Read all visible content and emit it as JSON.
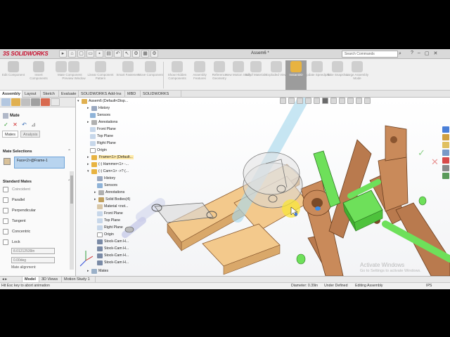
{
  "app": {
    "brand": "SOLIDWORKS",
    "document_title": "Assem6 *",
    "search_placeholder": "Search Commands"
  },
  "command_manager": [
    {
      "label": "Edit Component",
      "active": false
    },
    {
      "label": "Insert Components",
      "active": false
    },
    {
      "label": "Mate",
      "active": false
    },
    {
      "label": "Component Preview Window",
      "active": false
    },
    {
      "label": "Linear Component Pattern",
      "active": false
    },
    {
      "label": "Smart Fasteners",
      "active": false
    },
    {
      "label": "Move Component",
      "active": false
    },
    {
      "label": "Show Hidden Components",
      "active": false
    },
    {
      "label": "Assembly Features",
      "active": false
    },
    {
      "label": "Reference Geometry",
      "active": false
    },
    {
      "label": "New Motion Study",
      "active": false
    },
    {
      "label": "Bill of Materials",
      "active": false
    },
    {
      "label": "Exploded View",
      "active": false
    },
    {
      "label": "Instant3D",
      "active": true
    },
    {
      "label": "Update Speedpak",
      "active": false
    },
    {
      "label": "Take Snapshot",
      "active": false
    },
    {
      "label": "Large Assembly Mode",
      "active": false
    }
  ],
  "tabs": [
    "Assembly",
    "Layout",
    "Sketch",
    "Evaluate",
    "SOLIDWORKS Add-Ins",
    "MBD",
    "SOLIDWORKS CAM"
  ],
  "active_tab": "Assembly",
  "property_manager": {
    "title": "Mate",
    "subtabs": [
      "Mates",
      "Analysis"
    ],
    "mate_selections_title": "Mate Selections",
    "selection": "Face<2>@Frame-1",
    "standard_mates_title": "Standard Mates",
    "mates": [
      "Coincident",
      "Parallel",
      "Perpendicular",
      "Tangent",
      "Concentric",
      "Lock"
    ],
    "distance_value": "8.01212539in",
    "angle_value": "0.00deg",
    "alignment_label": "Mate alignment:"
  },
  "tree": [
    {
      "label": "Assem6 (Default<Disp...",
      "level": 0
    },
    {
      "label": "History",
      "level": 1
    },
    {
      "label": "Sensors",
      "level": 1
    },
    {
      "label": "Annotations",
      "level": 1
    },
    {
      "label": "Front Plane",
      "level": 1
    },
    {
      "label": "Top Plane",
      "level": 1
    },
    {
      "label": "Right Plane",
      "level": 1
    },
    {
      "label": "Origin",
      "level": 1
    },
    {
      "label": "Frame<1> (Default...",
      "level": 1
    },
    {
      "label": "(-) Hammer<1> -...",
      "level": 1
    },
    {
      "label": "(-) Cam<1> ->? (...",
      "level": 1
    },
    {
      "label": "History",
      "level": 2
    },
    {
      "label": "Sensors",
      "level": 2
    },
    {
      "label": "Annotations",
      "level": 2
    },
    {
      "label": "Solid Bodies(4)",
      "level": 2
    },
    {
      "label": "Material <not...",
      "level": 2
    },
    {
      "label": "Front Plane",
      "level": 2
    },
    {
      "label": "Top Plane",
      "level": 2
    },
    {
      "label": "Right Plane",
      "level": 2
    },
    {
      "label": "Origin",
      "level": 2
    },
    {
      "label": "Stock-Cam H...",
      "level": 2
    },
    {
      "label": "Stock-Cam H...",
      "level": 2
    },
    {
      "label": "Stock-Cam H...",
      "level": 2
    },
    {
      "label": "Stock-Cam H...",
      "level": 2
    },
    {
      "label": "Mates",
      "level": 1
    }
  ],
  "bottom_tabs": [
    "Model",
    "3D Views",
    "Motion Study 1"
  ],
  "status": {
    "left": "Hit Esc key to abort animation",
    "diameter": "Diameter: 0.39in",
    "state": "Under Defined",
    "mode": "Editing Assembly",
    "units": "IPS"
  },
  "watermark": {
    "line1": "Activate Windows",
    "line2": "Go to Settings to activate Windows."
  },
  "colors": {
    "wood": "#b97a4e",
    "wood_light": "#f3c98c",
    "green_part": "#6ee05a",
    "selection_blue": "#b8d4ef",
    "instant3d_active": "#9c9c9c"
  }
}
